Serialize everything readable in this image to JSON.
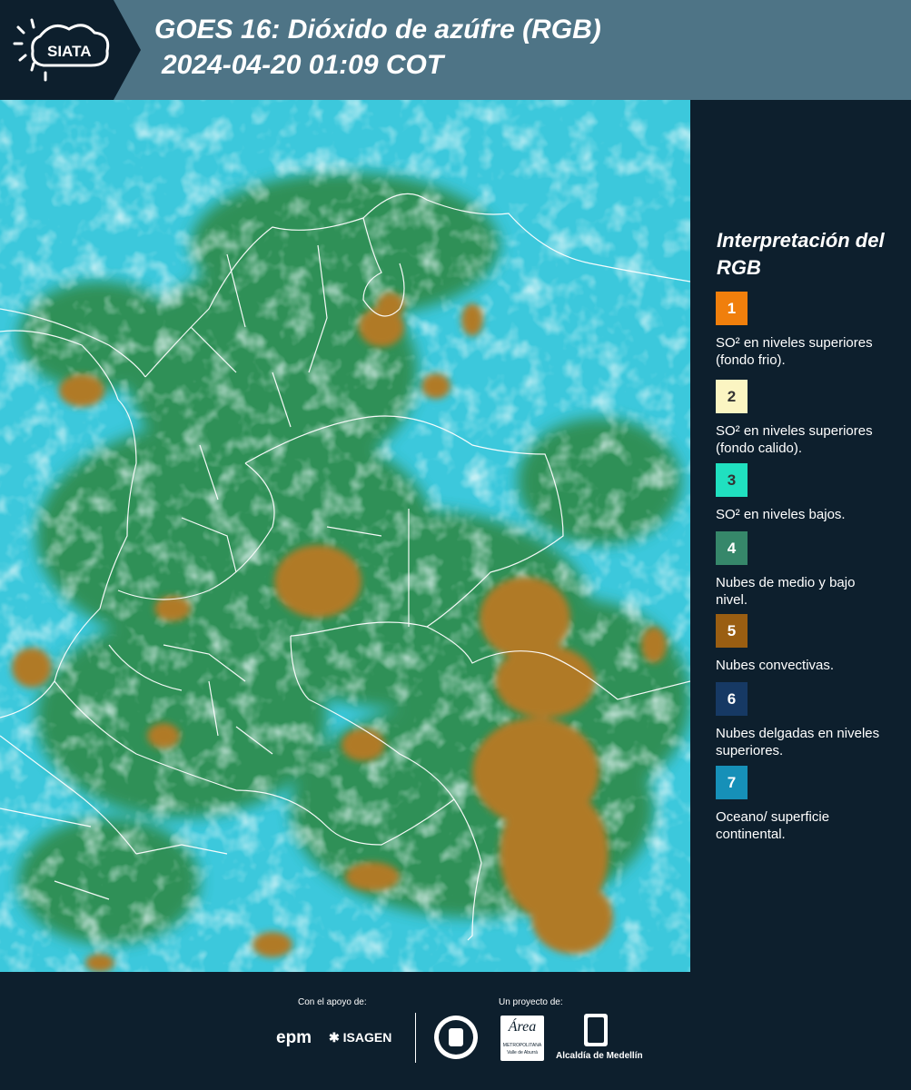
{
  "header": {
    "brand": "SIATA",
    "title_line1": "GOES 16: Dióxido de azúfre (RGB)",
    "title_line2": "2024-04-20 01:09 COT"
  },
  "legend": {
    "title": "Interpretación del RGB",
    "items": [
      {
        "number": "1",
        "color": "#f07f0c",
        "num_color": "#ffffff",
        "text": "SO² en niveles superiores (fondo frio)."
      },
      {
        "number": "2",
        "color": "#fbf5c2",
        "num_color": "#333333",
        "text": "SO² en niveles superiores (fondo calido)."
      },
      {
        "number": "3",
        "color": "#20e0c0",
        "num_color": "#333333",
        "text": "SO² en niveles bajos."
      },
      {
        "number": "4",
        "color": "#36876a",
        "num_color": "#ffffff",
        "text": "Nubes de medio y bajo nivel."
      },
      {
        "number": "5",
        "color": "#9a5e12",
        "num_color": "#ffffff",
        "text": "Nubes convectivas."
      },
      {
        "number": "6",
        "color": "#163964",
        "num_color": "#ffffff",
        "text": "Nubes delgadas en niveles superiores."
      },
      {
        "number": "7",
        "color": "#1690b8",
        "num_color": "#ffffff",
        "text": "Oceano/ superficie continental."
      }
    ]
  },
  "footer": {
    "support_label": "Con el apoyo de:",
    "project_label": "Un proyecto de:",
    "logos": {
      "epm": "epm",
      "isagen": "ISAGEN",
      "area": "Área",
      "area_sub": "METROPOLITANA",
      "area_sub2": "Valle de Aburrá",
      "alcaldia": "Alcaldía de Medellín"
    }
  },
  "map": {
    "colors": {
      "ocean": "#3cc8dc",
      "clear_land": "#2e8a4a",
      "convective": "#b07a28",
      "cloud": "#bfeef2"
    }
  }
}
